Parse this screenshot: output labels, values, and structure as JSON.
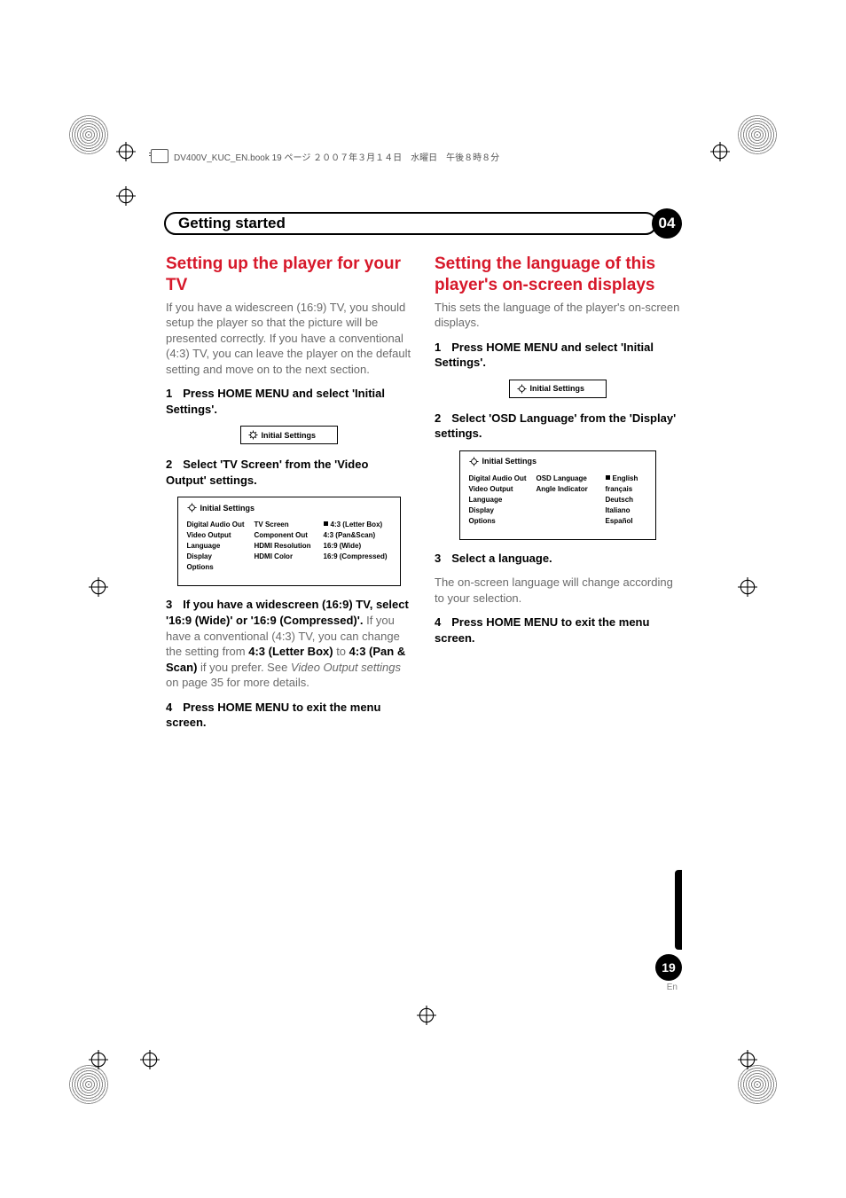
{
  "header_line": "DV400V_KUC_EN.book  19 ページ  ２００７年３月１４日　水曜日　午後８時８分",
  "chapter": {
    "title": "Getting started",
    "number": "04"
  },
  "left": {
    "heading": "Setting up the player for your TV",
    "intro": "If you have a widescreen (16:9) TV, you should setup the player so that the picture will be presented correctly. If you have a conventional (4:3) TV, you can leave the player on the default setting and move on to the next section.",
    "step1_num": "1",
    "step1": "Press HOME MENU and select 'Initial Settings'.",
    "ui_small": "Initial Settings",
    "step2_num": "2",
    "step2": "Select 'TV Screen' from the 'Video Output' settings.",
    "menu_title": "Initial Settings",
    "menu_col1": [
      "Digital Audio Out",
      "Video Output",
      "Language",
      "Display",
      "Options"
    ],
    "menu_col2": [
      "TV Screen",
      "Component Out",
      "HDMI Resolution",
      "HDMI Color"
    ],
    "menu_col3": [
      "4:3 (Letter Box)",
      "4:3 (Pan&Scan)",
      "16:9 (Wide)",
      "16:9 (Compressed)"
    ],
    "step3_num": "3",
    "step3_bold": "If you have a widescreen (16:9) TV, select '16:9 (Wide)' or '16:9 (Compressed)'.",
    "step3_body_a": "If you have a conventional (4:3) TV, you can change the setting from ",
    "step3_body_b": "4:3 (Letter Box)",
    "step3_body_c": " to ",
    "step3_body_d": "4:3 (Pan & Scan)",
    "step3_body_e": " if you prefer. See ",
    "step3_body_f": "Video Output settings",
    "step3_body_g": " on page 35 for more details.",
    "step4_num": "4",
    "step4": "Press HOME MENU to exit the menu screen."
  },
  "right": {
    "heading": "Setting the language of this player's on-screen displays",
    "intro": "This sets the language of the player's on-screen displays.",
    "step1_num": "1",
    "step1": "Press HOME MENU and select 'Initial Settings'.",
    "ui_small": "Initial Settings",
    "step2_num": "2",
    "step2": "Select 'OSD Language' from the 'Display' settings.",
    "menu_title": "Initial Settings",
    "menu_col1": [
      "Digital Audio Out",
      "Video Output",
      "Language",
      "Display",
      "Options"
    ],
    "menu_col2": [
      "OSD Language",
      "Angle Indicator"
    ],
    "menu_col3": [
      "English",
      "français",
      "Deutsch",
      "Italiano",
      "Español"
    ],
    "step3_num": "3",
    "step3": "Select a language.",
    "step3_body": "The on-screen language will change according to your selection.",
    "step4_num": "4",
    "step4": "Press HOME MENU to exit the menu screen."
  },
  "page_number": "19",
  "page_lang": "En"
}
